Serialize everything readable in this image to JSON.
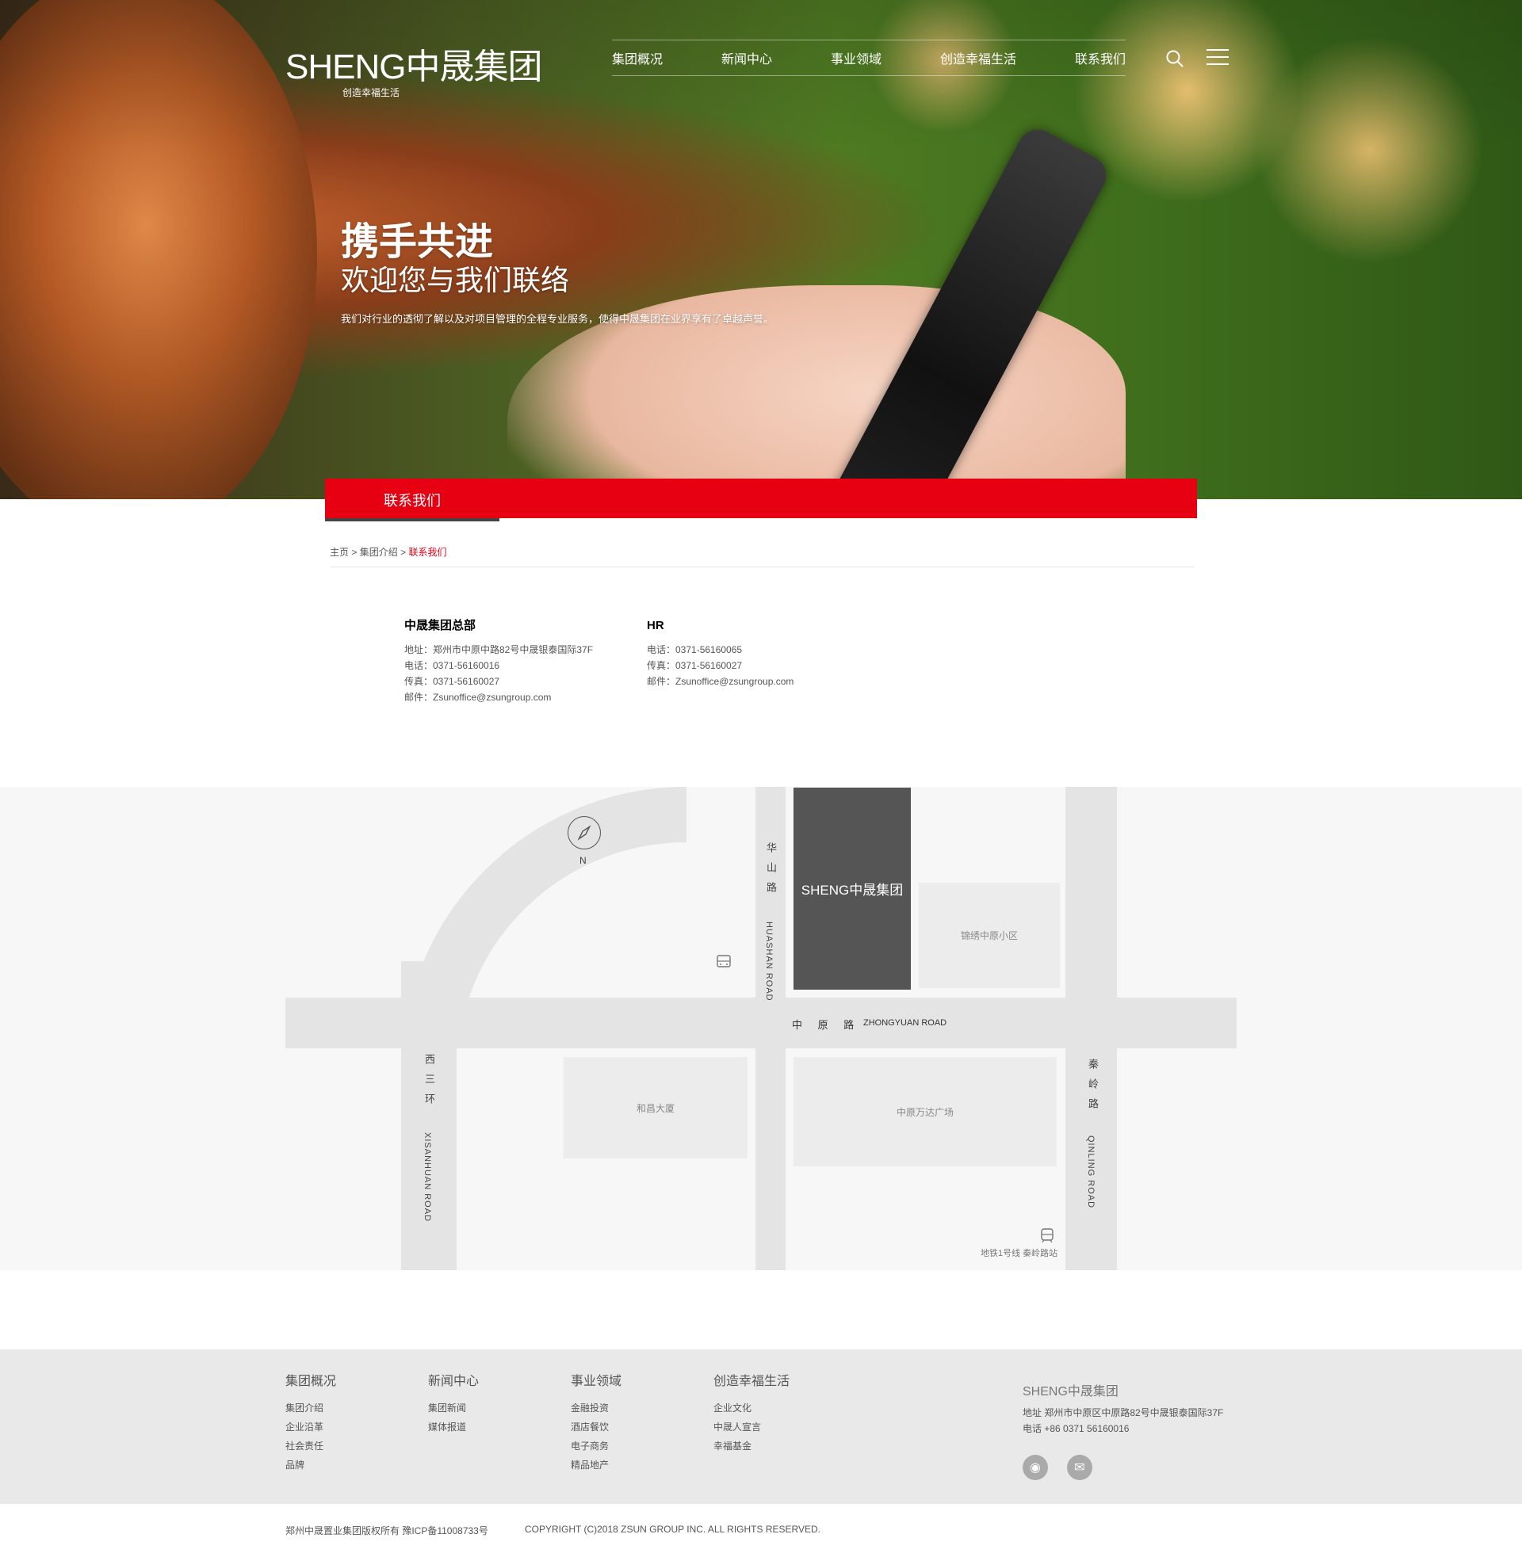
{
  "header": {
    "logo_text": "SHENG中晟集团",
    "logo_tagline": "创造幸福生活",
    "nav": [
      "集团概况",
      "新闻中心",
      "事业领域",
      "创造幸福生活",
      "联系我们"
    ]
  },
  "hero": {
    "title": "携手共进",
    "subtitle": "欢迎您与我们联络",
    "desc": "我们对行业的透彻了解以及对项目管理的全程专业服务，使得中晟集团在业界享有了卓越声誉。"
  },
  "section_tab": "联系我们",
  "breadcrumb": {
    "home": "主页",
    "sep1": ">",
    "parent": "集团介绍",
    "sep2": ">",
    "current": "联系我们"
  },
  "contacts": [
    {
      "title": "中晟集团总部",
      "lines": [
        "地址：郑州市中原中路82号中晟银泰国际37F",
        "电话：0371-56160016",
        "传真：0371-56160027",
        "邮件：Zsunoffice@zsungroup.com"
      ]
    },
    {
      "title": "HR",
      "lines": [
        "电话：0371-56160065",
        "传真：0371-56160027",
        "邮件：Zsunoffice@zsungroup.com"
      ]
    }
  ],
  "map": {
    "compass": "N",
    "huashan_cn": "华山路",
    "huashan_en": "HUASHAN ROAD",
    "hq_label": "SHENG中晟集团",
    "jinxiu": "锦绣中原小区",
    "zhongyuan_cn": "中 原 路",
    "zhongyuan_en": "ZHONGYUAN ROAD",
    "xisanhuan_cn": "西三环",
    "xisanhuan_en": "XISANHUAN ROAD",
    "hechang": "和昌大厦",
    "wanda": "中原万达广场",
    "qinling_cn": "秦岭路",
    "qinling_en": "QINLING ROAD",
    "metro": "地铁1号线 秦岭路站"
  },
  "footer": {
    "cols": [
      {
        "title": "集团概况",
        "links": [
          "集团介绍",
          "企业沿革",
          "社会责任",
          "品牌"
        ]
      },
      {
        "title": "新闻中心",
        "links": [
          "集团新闻",
          "媒体报道"
        ]
      },
      {
        "title": "事业领域",
        "links": [
          "金融投资",
          "酒店餐饮",
          "电子商务",
          "精品地产"
        ]
      },
      {
        "title": "创造幸福生活",
        "links": [
          "企业文化",
          "中晟人宣言",
          "幸福基金"
        ]
      }
    ],
    "logo": "SHENG中晟集团",
    "address": "地址 郑州市中原区中原路82号中晟银泰国际37F",
    "phone": "电话 +86 0371 56160016",
    "icp": "郑州中晟置业集团版权所有 豫ICP备11008733号",
    "copyright": "COPYRIGHT (C)2018 ZSUN GROUP INC. ALL RIGHTS RESERVED."
  },
  "colors": {
    "accent": "#e60012",
    "footer_bg": "#e9e9e9"
  }
}
